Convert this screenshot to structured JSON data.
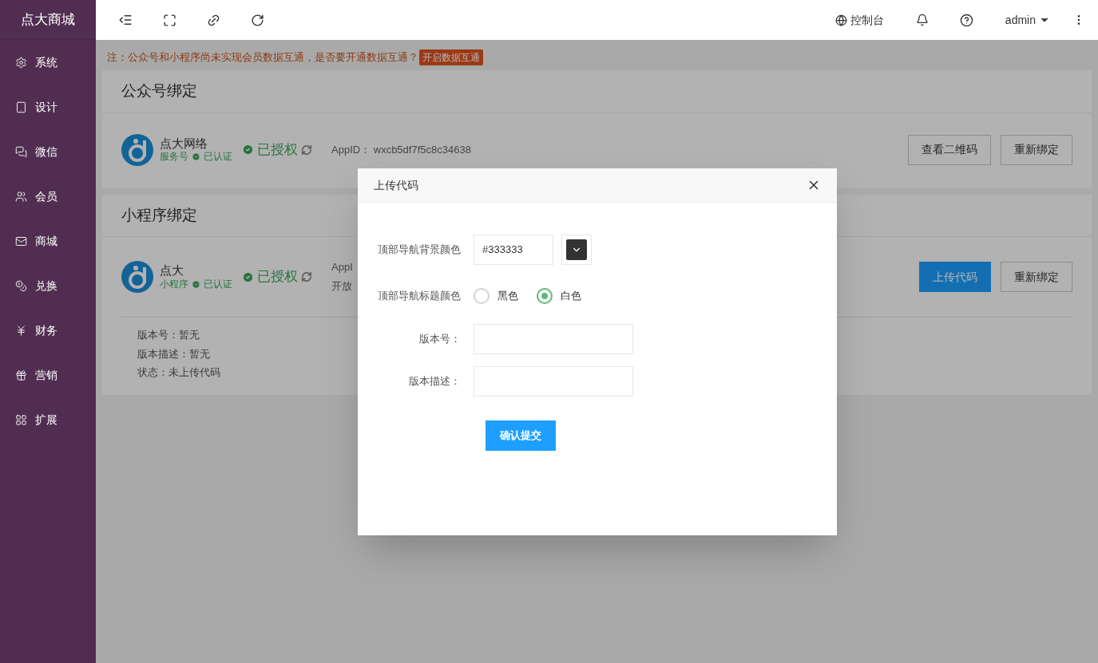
{
  "sidebar": {
    "title": "点大商城",
    "items": [
      {
        "label": "系统"
      },
      {
        "label": "设计"
      },
      {
        "label": "微信"
      },
      {
        "label": "会员"
      },
      {
        "label": "商城"
      },
      {
        "label": "兑换"
      },
      {
        "label": "财务"
      },
      {
        "label": "营销"
      },
      {
        "label": "扩展"
      }
    ]
  },
  "topbar": {
    "console": "控制台",
    "user": "admin"
  },
  "notice": {
    "text": "注：公众号和小程序尚未实现会员数据互通，是否要开通数据互通？",
    "action": "开启数据互通"
  },
  "cards": [
    {
      "title": "公众号绑定",
      "name": "点大网络",
      "type": "服务号",
      "verified": "已认证",
      "status": "已授权",
      "appid": "AppID：  wxcb5df7f5c8c34638",
      "buttons": [
        {
          "label": "查看二维码",
          "primary": false
        },
        {
          "label": "重新绑定",
          "primary": false
        }
      ]
    },
    {
      "title": "小程序绑定",
      "name": "点大",
      "type": "小程序",
      "verified": "已认证",
      "status": "已授权",
      "appid": "AppI",
      "platform": "开放",
      "buttons": [
        {
          "label": "上传代码",
          "primary": true
        },
        {
          "label": "重新绑定",
          "primary": false
        }
      ],
      "details": [
        "版本号：暂无",
        "版本描述：暂无",
        "状态：未上传代码"
      ]
    }
  ],
  "modal": {
    "title": "上传代码",
    "bg_label": "顶部导航背景颜色",
    "bg_value": "#333333",
    "title_color_label": "顶部导航标题颜色",
    "options": [
      {
        "label": "黑色",
        "selected": false
      },
      {
        "label": "白色",
        "selected": true
      }
    ],
    "version_label": "版本号：",
    "desc_label": "版本描述：",
    "submit": "确认提交"
  }
}
